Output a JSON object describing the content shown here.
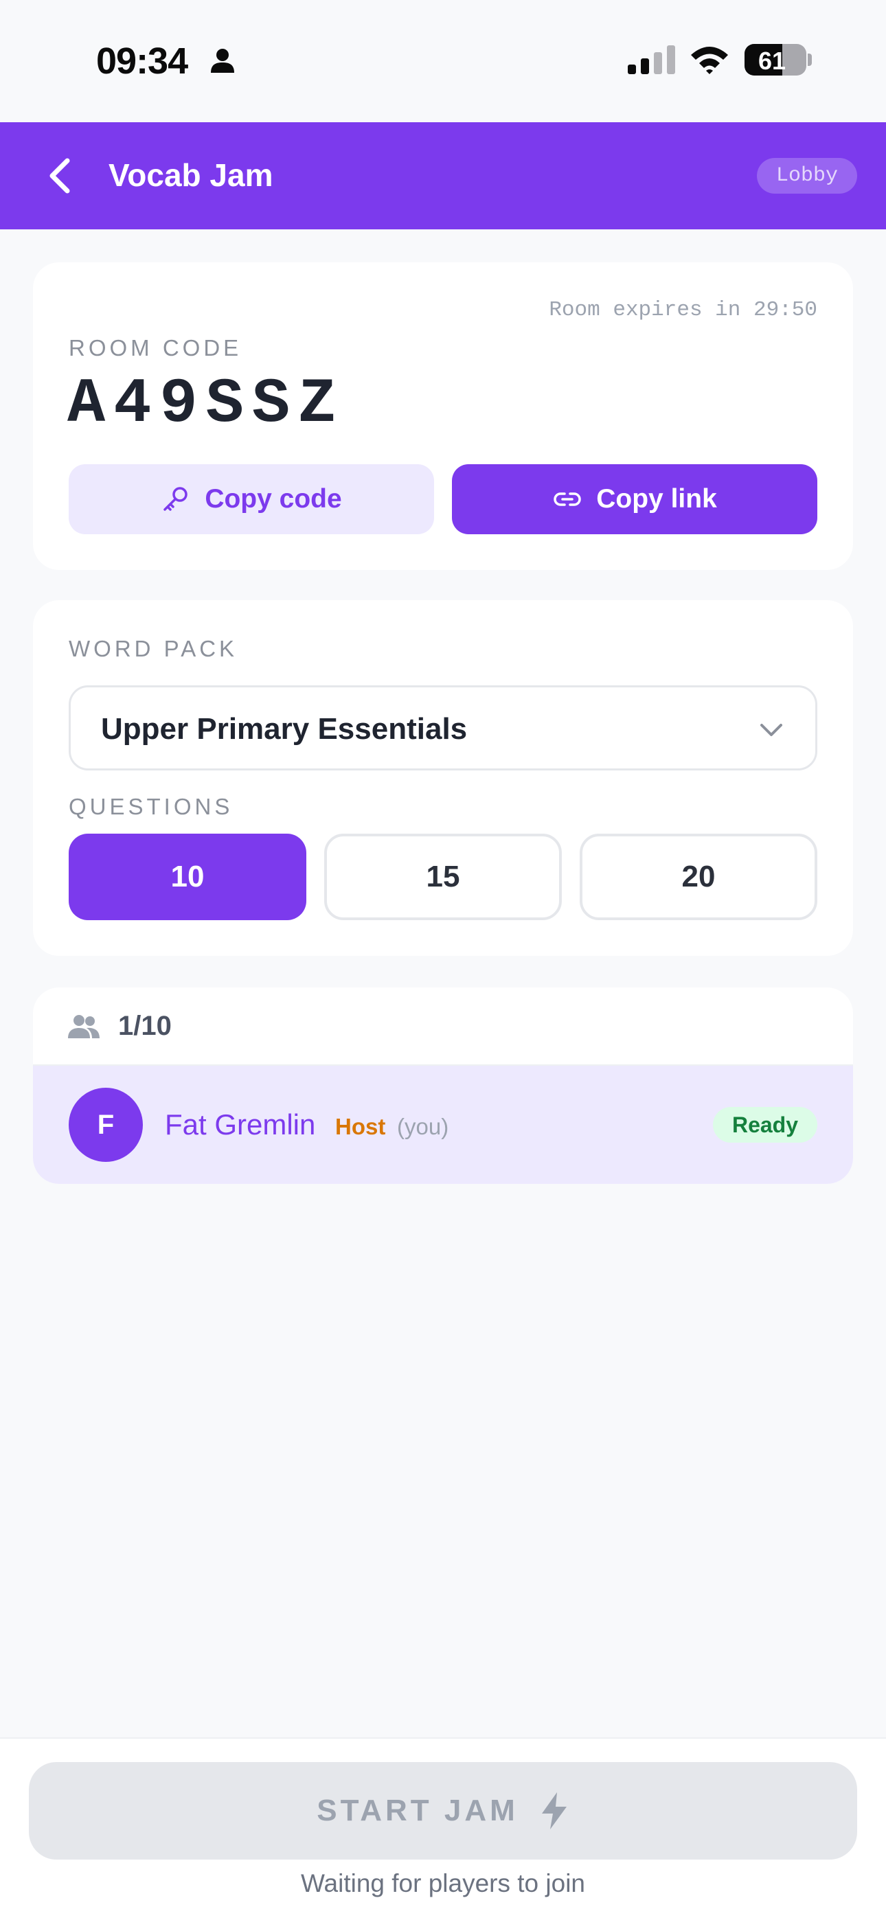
{
  "status_bar": {
    "time": "09:34",
    "battery": "61",
    "icons": [
      "person-icon",
      "signal-icon",
      "wifi-icon",
      "battery-icon"
    ]
  },
  "header": {
    "title": "Vocab Jam",
    "badge": "Lobby",
    "back_icon": "chevron-left-icon",
    "background": "#7c3aed"
  },
  "room": {
    "expiry": "Room expires in 29:50",
    "label": "ROOM CODE",
    "code": "A49SSZ",
    "copy_code_label": "Copy code",
    "copy_link_label": "Copy link",
    "copy_code_icon": "key-icon",
    "copy_link_icon": "link-icon"
  },
  "settings": {
    "word_pack_label": "WORD PACK",
    "word_pack_value": "Upper Primary Essentials",
    "questions_label": "QUESTIONS",
    "question_options": [
      "10",
      "15",
      "20"
    ],
    "selected_question": "10"
  },
  "players": {
    "count": "1/10",
    "icon": "users-icon",
    "list": [
      {
        "initial": "F",
        "name": "Fat Gremlin",
        "role": "Host",
        "self_tag": "(you)",
        "status": "Ready"
      }
    ]
  },
  "footer": {
    "start_label": "START JAM",
    "start_icon": "bolt-icon",
    "waiting_text": "Waiting for players to join"
  },
  "colors": {
    "accent": "#7c3aed",
    "accent_light": "#ede9fe",
    "host": "#d97706",
    "ready": "#15803d",
    "ready_bg": "#dcfce7",
    "disabled": "#e5e7eb"
  }
}
